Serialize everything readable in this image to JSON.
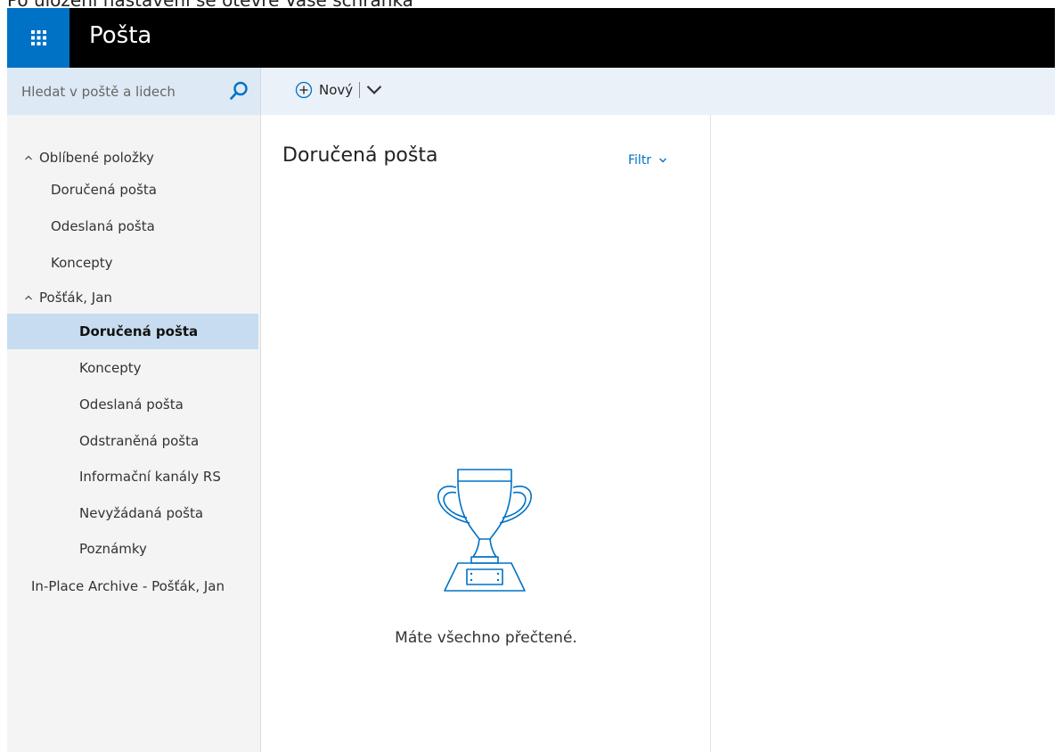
{
  "caption": "Po úložení nastavení se otevře Vaše schránka",
  "header": {
    "title": "Pošta",
    "waffle_icon": "app-launcher-icon"
  },
  "search": {
    "placeholder": "Hledat v poště a lidech",
    "icon": "search-icon"
  },
  "toolbar": {
    "new_label": "Nový",
    "new_icon": "add-circle-icon"
  },
  "sidebar": {
    "favorites_label": "Oblíbené položky",
    "favorites": [
      {
        "label": "Doručená pošta"
      },
      {
        "label": "Odeslaná pošta"
      },
      {
        "label": "Koncepty"
      }
    ],
    "account_label": "Pošťák, Jan",
    "folders": [
      {
        "label": "Doručená pošta",
        "selected": true
      },
      {
        "label": "Koncepty"
      },
      {
        "label": "Odeslaná pošta"
      },
      {
        "label": "Odstraněná pošta"
      },
      {
        "label": "Informační kanály RS"
      },
      {
        "label": "Nevyžádaná pošta"
      },
      {
        "label": "Poznámky"
      }
    ],
    "archive_label": "In-Place Archive - Pošťák, Jan"
  },
  "list": {
    "title": "Doručená pošta",
    "filter_label": "Filtr",
    "empty_message": "Máte všechno přečtené.",
    "empty_icon": "trophy-icon"
  },
  "colors": {
    "accent": "#0072c6",
    "topbar": "#000000",
    "selected": "#c7dcf0",
    "nav_bg": "#f4f4f4",
    "cmd_bg": "#eaf1f8"
  }
}
